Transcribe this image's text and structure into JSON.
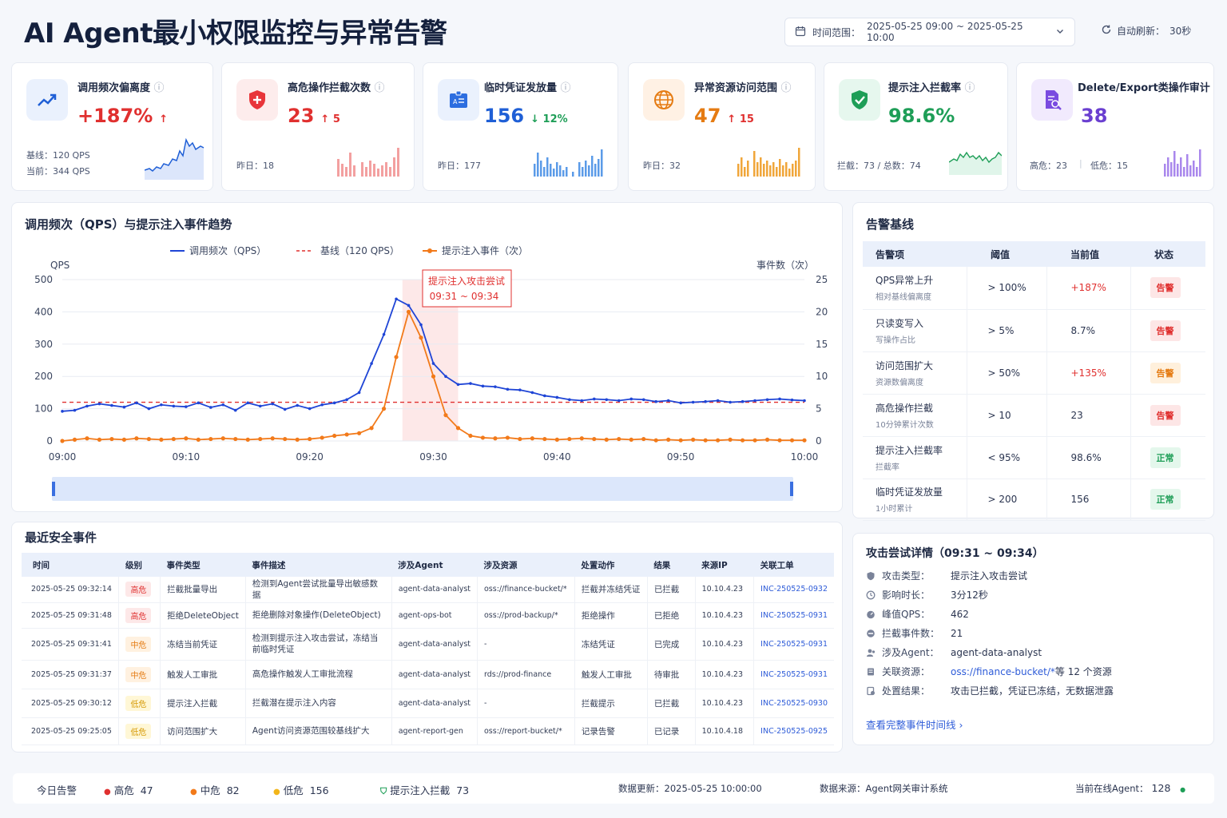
{
  "header": {
    "title": "AI Agent最小权限监控与异常告警",
    "time_label": "时间范围：",
    "time_range": "2025-05-25 09:00 ~ 2025-05-25 10:00",
    "refresh_label": "自动刷新：",
    "refresh_value": "30秒"
  },
  "kpis": [
    {
      "title": "调用频次偏离度",
      "value": "+187%",
      "delta": "↑",
      "foot1": "基线：120 QPS",
      "foot2": "当前：344 QPS",
      "color": "#e0302f",
      "icon": "trend-up-icon"
    },
    {
      "title": "高危操作拦截次数",
      "value": "23",
      "delta": "↑ 5",
      "foot1": "昨日：18",
      "color": "#e0302f",
      "icon": "shield-plus-icon"
    },
    {
      "title": "临时凭证发放量",
      "value": "156",
      "delta": "↓ 12%",
      "foot1": "昨日：177",
      "color": "#1f5fd6",
      "delta_color": "#1e9e57",
      "icon": "id-badge-icon"
    },
    {
      "title": "异常资源访问范围",
      "value": "47",
      "delta": "↑ 15",
      "foot1": "昨日：32",
      "color": "#e57b12",
      "icon": "globe-icon"
    },
    {
      "title": "提示注入拦截率",
      "value": "98.6%",
      "foot1": "拦截：73 / 总数：74",
      "color": "#1e9e57",
      "icon": "shield-check-icon"
    },
    {
      "title": "Delete/Export类操作审计",
      "value": "38",
      "foot1": "高危：23",
      "foot2": "低危：15",
      "color": "#6a3fd0",
      "icon": "document-search-icon"
    }
  ],
  "trend": {
    "title": "调用频次（QPS）与提示注入事件趋势",
    "legend_qps": "调用频次（QPS）",
    "legend_base": "基线（120 QPS）",
    "legend_inj": "提示注入事件（次）",
    "ylabel_left": "QPS",
    "ylabel_right": "事件数（次）",
    "annotation_title": "提示注入攻击尝试",
    "annotation_time": "09:31 ~ 09:34"
  },
  "chart_data": {
    "type": "line",
    "x": [
      "09:00",
      "09:01",
      "09:02",
      "09:03",
      "09:04",
      "09:05",
      "09:06",
      "09:07",
      "09:08",
      "09:09",
      "09:10",
      "09:11",
      "09:12",
      "09:13",
      "09:14",
      "09:15",
      "09:16",
      "09:17",
      "09:18",
      "09:19",
      "09:20",
      "09:21",
      "09:22",
      "09:23",
      "09:24",
      "09:25",
      "09:26",
      "09:27",
      "09:28",
      "09:29",
      "09:30",
      "09:31",
      "09:32",
      "09:33",
      "09:34",
      "09:35",
      "09:36",
      "09:37",
      "09:38",
      "09:39",
      "09:40",
      "09:41",
      "09:42",
      "09:43",
      "09:44",
      "09:45",
      "09:46",
      "09:47",
      "09:48",
      "09:49",
      "09:50",
      "09:51",
      "09:52",
      "09:53",
      "09:54",
      "09:55",
      "09:56",
      "09:57",
      "09:58",
      "09:59",
      "10:00"
    ],
    "x_ticks": [
      "09:00",
      "09:10",
      "09:20",
      "09:30",
      "09:40",
      "09:50",
      "10:00"
    ],
    "y_left_ticks": [
      0,
      100,
      200,
      300,
      400,
      500
    ],
    "y_right_ticks": [
      0,
      5,
      10,
      15,
      20,
      25
    ],
    "ylim_left": [
      0,
      500
    ],
    "ylim_right": [
      0,
      25
    ],
    "baseline": 120,
    "highlight": [
      "09:27.5",
      "09:32"
    ],
    "series": [
      {
        "name": "调用频次（QPS）",
        "axis": "left",
        "color": "#1f45d6",
        "values": [
          92,
          95,
          108,
          115,
          110,
          105,
          118,
          100,
          112,
          108,
          106,
          118,
          104,
          112,
          95,
          118,
          108,
          115,
          98,
          110,
          100,
          112,
          118,
          128,
          150,
          240,
          330,
          440,
          420,
          360,
          240,
          200,
          175,
          178,
          170,
          168,
          160,
          158,
          150,
          140,
          135,
          128,
          125,
          130,
          128,
          125,
          130,
          128,
          122,
          125,
          118,
          120,
          122,
          125,
          120,
          122,
          125,
          128,
          130,
          127,
          125
        ]
      },
      {
        "name": "提示注入事件（次）",
        "axis": "right",
        "color": "#f27a1a",
        "values": [
          0,
          0.2,
          0.4,
          0.2,
          0.3,
          0.2,
          0.4,
          0.3,
          0.2,
          0.3,
          0.4,
          0.2,
          0.3,
          0.4,
          0.3,
          0.2,
          0.3,
          0.4,
          0.3,
          0.2,
          0.3,
          0.5,
          0.8,
          1.0,
          1.2,
          2,
          5,
          13,
          20,
          16,
          10,
          4,
          2,
          0.8,
          0.5,
          0.4,
          0.5,
          0.3,
          0.4,
          0.3,
          0.2,
          0.3,
          0.4,
          0.3,
          0.2,
          0.3,
          0.2,
          0.3,
          0.1,
          0.2,
          0.1,
          0.2,
          0.1,
          0.1,
          0.2,
          0.1,
          0.1,
          0.2,
          0.1,
          0.1,
          0.1
        ]
      }
    ]
  },
  "baseline_table": {
    "title": "告警基线",
    "headers": [
      "告警项",
      "阈值",
      "当前值",
      "状态"
    ],
    "rows": [
      {
        "name": "QPS异常上升",
        "sub": "相对基线偏离度",
        "th": "> 100%",
        "cur": "+187%",
        "status": "告警",
        "cur_color": "#e0302f",
        "st": "red"
      },
      {
        "name": "只读变写入",
        "sub": "写操作占比",
        "th": "> 5%",
        "cur": "8.7%",
        "status": "告警",
        "st": "red"
      },
      {
        "name": "访问范围扩大",
        "sub": "资源数偏离度",
        "th": "> 50%",
        "cur": "+135%",
        "status": "告警",
        "cur_color": "#e0302f",
        "st": "org"
      },
      {
        "name": "高危操作拦截",
        "sub": "10分钟累计次数",
        "th": "> 10",
        "cur": "23",
        "status": "告警",
        "st": "red"
      },
      {
        "name": "提示注入拦截率",
        "sub": "拦截率",
        "th": "< 95%",
        "cur": "98.6%",
        "status": "正常",
        "st": "grn"
      },
      {
        "name": "临时凭证发放量",
        "sub": "1小时累计",
        "th": "> 200",
        "cur": "156",
        "status": "正常",
        "st": "grn"
      }
    ]
  },
  "events": {
    "title": "最近安全事件",
    "headers": [
      "时间",
      "级别",
      "事件类型",
      "事件描述",
      "涉及Agent",
      "涉及资源",
      "处置动作",
      "结果",
      "来源IP",
      "关联工单"
    ],
    "rows": [
      [
        "2025-05-25 09:32:14",
        "高危",
        "拦截批量导出",
        "检测到Agent尝试批量导出敏感数据",
        "agent-data-analyst",
        "oss://finance-bucket/*",
        "拦截并冻结凭证",
        "已拦截",
        "10.10.4.23",
        "INC-250525-0932"
      ],
      [
        "2025-05-25 09:31:48",
        "高危",
        "拒绝DeleteObject",
        "拒绝删除对象操作(DeleteObject)",
        "agent-ops-bot",
        "oss://prod-backup/*",
        "拒绝操作",
        "已拒绝",
        "10.10.4.23",
        "INC-250525-0931"
      ],
      [
        "2025-05-25 09:31:41",
        "中危",
        "冻结当前凭证",
        "检测到提示注入攻击尝试，冻结当前临时凭证",
        "agent-data-analyst",
        "-",
        "冻结凭证",
        "已完成",
        "10.10.4.23",
        "INC-250525-0931"
      ],
      [
        "2025-05-25 09:31:37",
        "中危",
        "触发人工审批",
        "高危操作触发人工审批流程",
        "agent-data-analyst",
        "rds://prod-finance",
        "触发人工审批",
        "待审批",
        "10.10.4.23",
        "INC-250525-0931"
      ],
      [
        "2025-05-25 09:30:12",
        "低危",
        "提示注入拦截",
        "拦截潜在提示注入内容",
        "agent-data-analyst",
        "-",
        "拦截提示",
        "已拦截",
        "10.10.4.23",
        "INC-250525-0930"
      ],
      [
        "2025-05-25 09:25:05",
        "低危",
        "访问范围扩大",
        "Agent访问资源范围较基线扩大",
        "agent-report-gen",
        "oss://report-bucket/*",
        "记录告警",
        "已记录",
        "10.10.4.18",
        "INC-250525-0925"
      ]
    ]
  },
  "detail": {
    "title": "攻击尝试详情（09:31 ~ 09:34）",
    "rows": [
      {
        "label": "攻击类型：",
        "value": "提示注入攻击尝试",
        "icon": "shield-icon"
      },
      {
        "label": "影响时长：",
        "value": "3分12秒",
        "icon": "clock-icon"
      },
      {
        "label": "峰值QPS：",
        "value": "462",
        "icon": "gauge-icon"
      },
      {
        "label": "拦截事件数：",
        "value": "21",
        "icon": "block-icon"
      },
      {
        "label": "涉及Agent：",
        "value": "agent-data-analyst",
        "icon": "user-icon"
      },
      {
        "label": "关联资源：",
        "value": "oss://finance-bucket/*",
        "value2": " 等 12 个资源",
        "icon": "database-icon"
      },
      {
        "label": "处置结果：",
        "value": "攻击已拦截，凭证已冻结，无数据泄露",
        "icon": "result-icon"
      }
    ],
    "link": "查看完整事件时间线 ›"
  },
  "footer": {
    "today": "今日告警",
    "high_label": "高危",
    "high": "47",
    "mid_label": "中危",
    "mid": "82",
    "low_label": "低危",
    "low": "156",
    "inj_label": "提示注入拦截",
    "inj": "73",
    "update": "数据更新：2025-05-25 10:00:00",
    "source": "数据来源：Agent网关审计系统",
    "online_label": "当前在线Agent：",
    "online": "128"
  }
}
